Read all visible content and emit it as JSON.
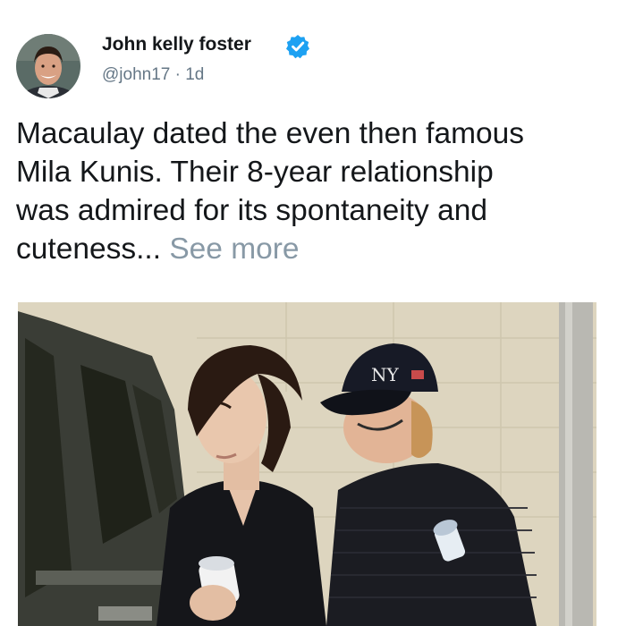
{
  "author": {
    "name": "John kelly foster",
    "handle": "@john17",
    "separator": "·",
    "timestamp": "1d",
    "verified": true,
    "avatar_icon": "profile-photo"
  },
  "tweet": {
    "text_lines": [
      "Macaulay dated the even then famous",
      "Mila Kunis. Their 8-year relationship",
      "was admired for its spontaneity and",
      "cuteness..."
    ],
    "see_more_label": "See more"
  },
  "media": {
    "type": "photo",
    "cap_logo": "NY"
  },
  "colors": {
    "text": "#14171a",
    "secondary": "#657786",
    "see_more": "#8899a6",
    "verified_badge": "#1da1f2"
  }
}
